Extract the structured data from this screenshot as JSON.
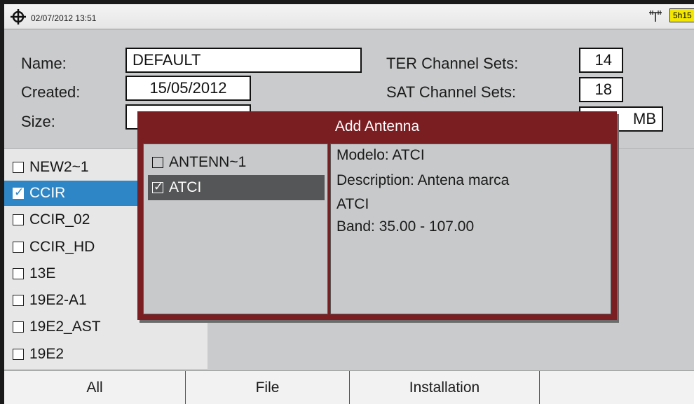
{
  "status_bar": {
    "datetime": "02/07/2012 13:51",
    "battery": "5h15",
    "left_icon": "gps-crosshair-icon",
    "right_icon": "antenna-signal-icon",
    "battery_color": "#f3e600"
  },
  "info": {
    "name_label": "Name:",
    "name_value": "DEFAULT",
    "created_label": "Created:",
    "created_value": "15/05/2012",
    "size_label": "Size:",
    "size_value": "",
    "ter_label": "TER Channel Sets:",
    "ter_value": "14",
    "sat_label": "SAT Channel Sets:",
    "sat_value": "18",
    "size_unit": "MB"
  },
  "channel_list": {
    "items": [
      {
        "label": "NEW2~1",
        "checked": false,
        "selected": false
      },
      {
        "label": "CCIR",
        "checked": true,
        "selected": true
      },
      {
        "label": "CCIR_02",
        "checked": false,
        "selected": false
      },
      {
        "label": "CCIR_HD",
        "checked": false,
        "selected": false
      },
      {
        "label": "13E",
        "checked": false,
        "selected": false
      },
      {
        "label": "19E2-A1",
        "checked": false,
        "selected": false
      },
      {
        "label": "19E2_AST",
        "checked": false,
        "selected": false
      },
      {
        "label": "19E2",
        "checked": false,
        "selected": false
      }
    ],
    "selected_color": "#2f86c6"
  },
  "dialog": {
    "title": "Add Antenna",
    "title_bg": "#7a1e22",
    "antennas": [
      {
        "label": "ANTENN~1",
        "checked": false,
        "selected": false
      },
      {
        "label": "ATCI",
        "checked": true,
        "selected": true
      }
    ],
    "details": {
      "model": "Modelo: ATCI",
      "description": "Description: Antena marca",
      "description_cont": "ATCI",
      "band": "Band: 35.00 - 107.00"
    }
  },
  "softkeys": [
    "All",
    "File",
    "Installation",
    ""
  ]
}
